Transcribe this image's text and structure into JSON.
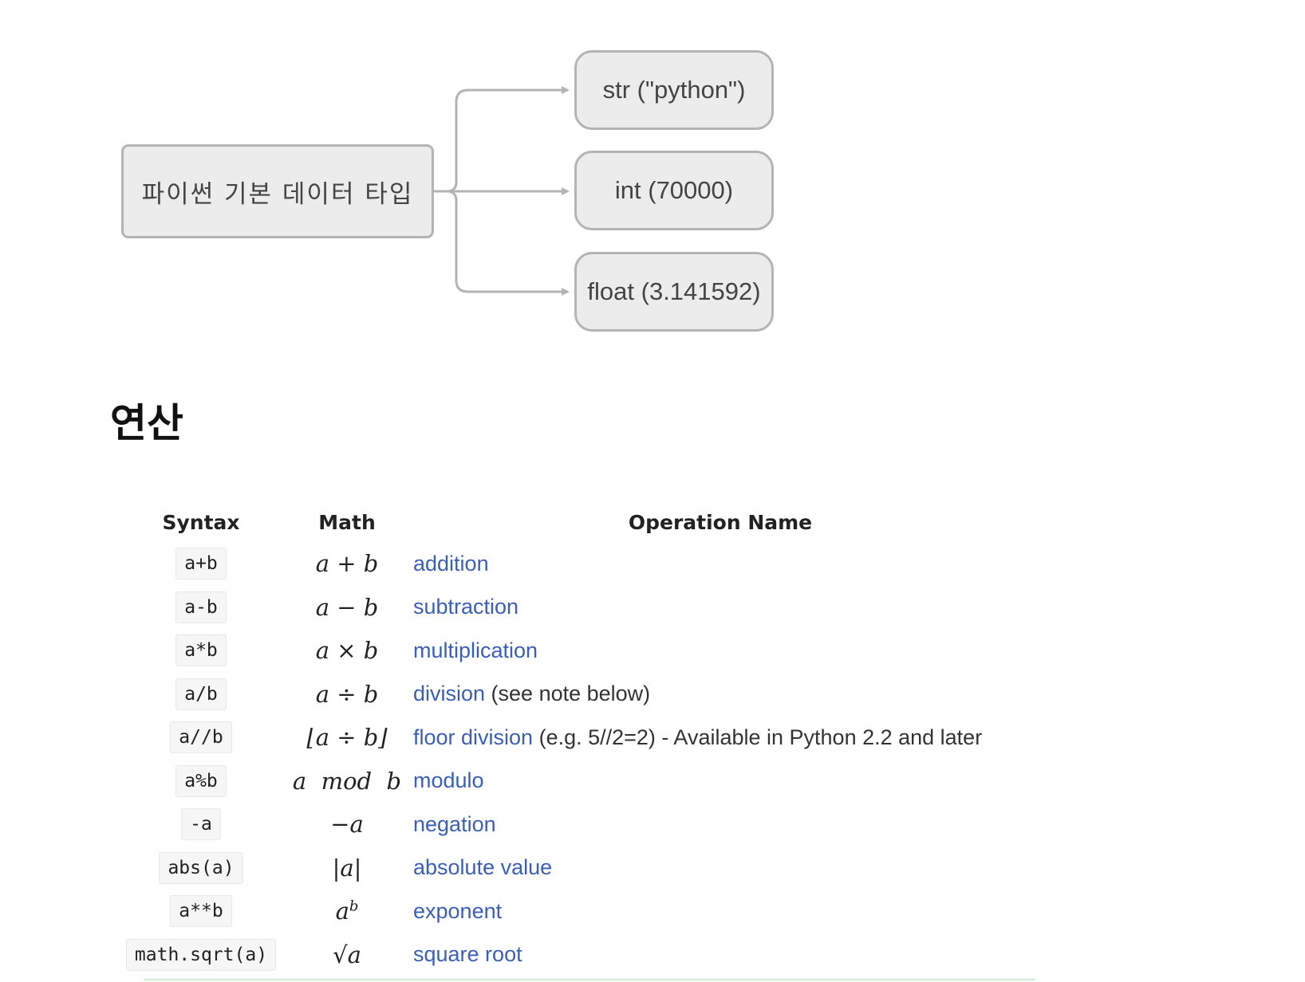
{
  "diagram": {
    "root": "파이썬 기본 데이터 타입",
    "children": [
      "str (\"python\")",
      "int (70000)",
      "float (3.141592)"
    ]
  },
  "section_title": "연산",
  "table": {
    "headers": {
      "syntax": "Syntax",
      "math": "Math",
      "operation": "Operation Name"
    },
    "rows": [
      {
        "syntax": "a+b",
        "math": "a + b",
        "op": "addition",
        "note": ""
      },
      {
        "syntax": "a-b",
        "math": "a − b",
        "op": "subtraction",
        "note": ""
      },
      {
        "syntax": "a*b",
        "math": "a × b",
        "op": "multiplication",
        "note": ""
      },
      {
        "syntax": "a/b",
        "math": "a ÷ b",
        "op": "division",
        "note": " (see note below)"
      },
      {
        "syntax": "a//b",
        "math": "⌊a ÷ b⌋",
        "op": "floor division",
        "note": " (e.g. 5//2=2) - Available in Python 2.2 and later"
      },
      {
        "syntax": "a%b",
        "math": "a  mod  b",
        "op": "modulo",
        "note": ""
      },
      {
        "syntax": "-a",
        "math": "−a",
        "op": "negation",
        "note": ""
      },
      {
        "syntax": "abs(a)",
        "math": "|a|",
        "op": "absolute value",
        "note": ""
      },
      {
        "syntax": "a**b",
        "math": "a",
        "math_sup": "b",
        "op": "exponent",
        "note": ""
      },
      {
        "syntax": "math.sqrt(a)",
        "math": "√a",
        "op": "square root",
        "note": ""
      }
    ]
  },
  "colors": {
    "link": "#3a5fb8",
    "node_fill": "#ececec",
    "node_border": "#b4b4b4",
    "connector": "#b4b4b4"
  }
}
